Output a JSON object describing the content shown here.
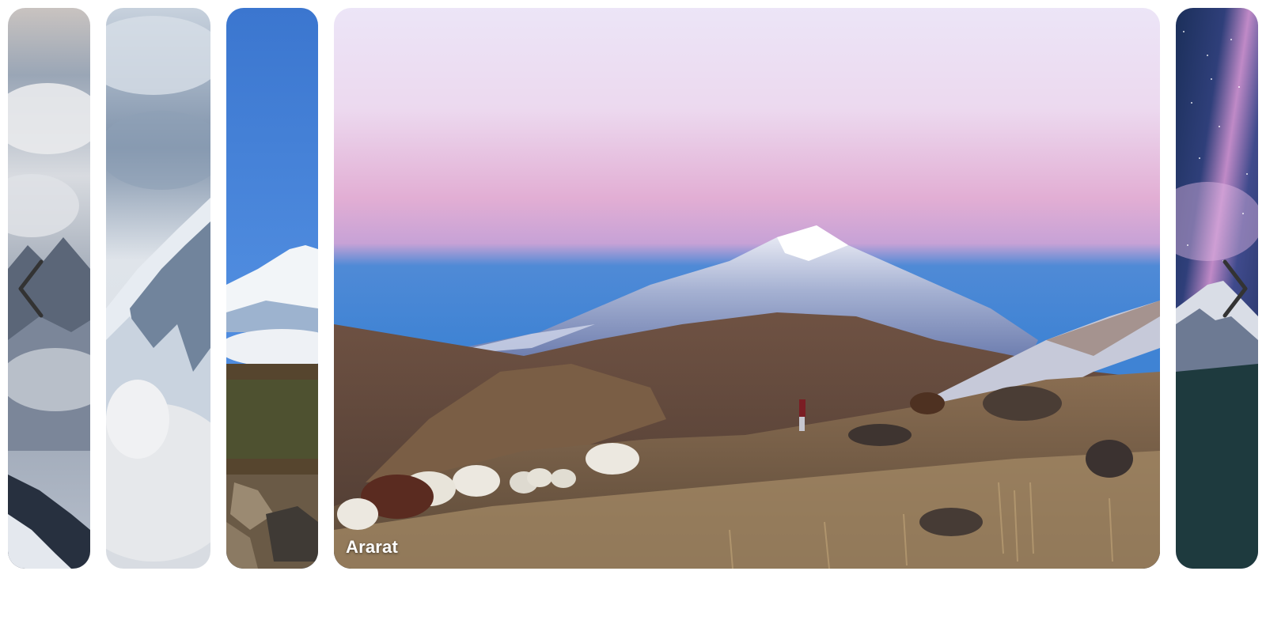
{
  "gallery": {
    "active_caption": "Ararat",
    "slides": [
      {
        "icon": "mountain-clouds-image"
      },
      {
        "icon": "snowy-peak-image"
      },
      {
        "icon": "blue-sky-summit-image"
      },
      {
        "icon": "ararat-image"
      },
      {
        "icon": "milky-way-mountain-image"
      }
    ]
  },
  "nav": {
    "prev_icon": "chevron-left-icon",
    "next_icon": "chevron-right-icon"
  },
  "colors": {
    "background": "#ffffff",
    "caption": "#ffffff",
    "nav_arrow": "#333333"
  }
}
